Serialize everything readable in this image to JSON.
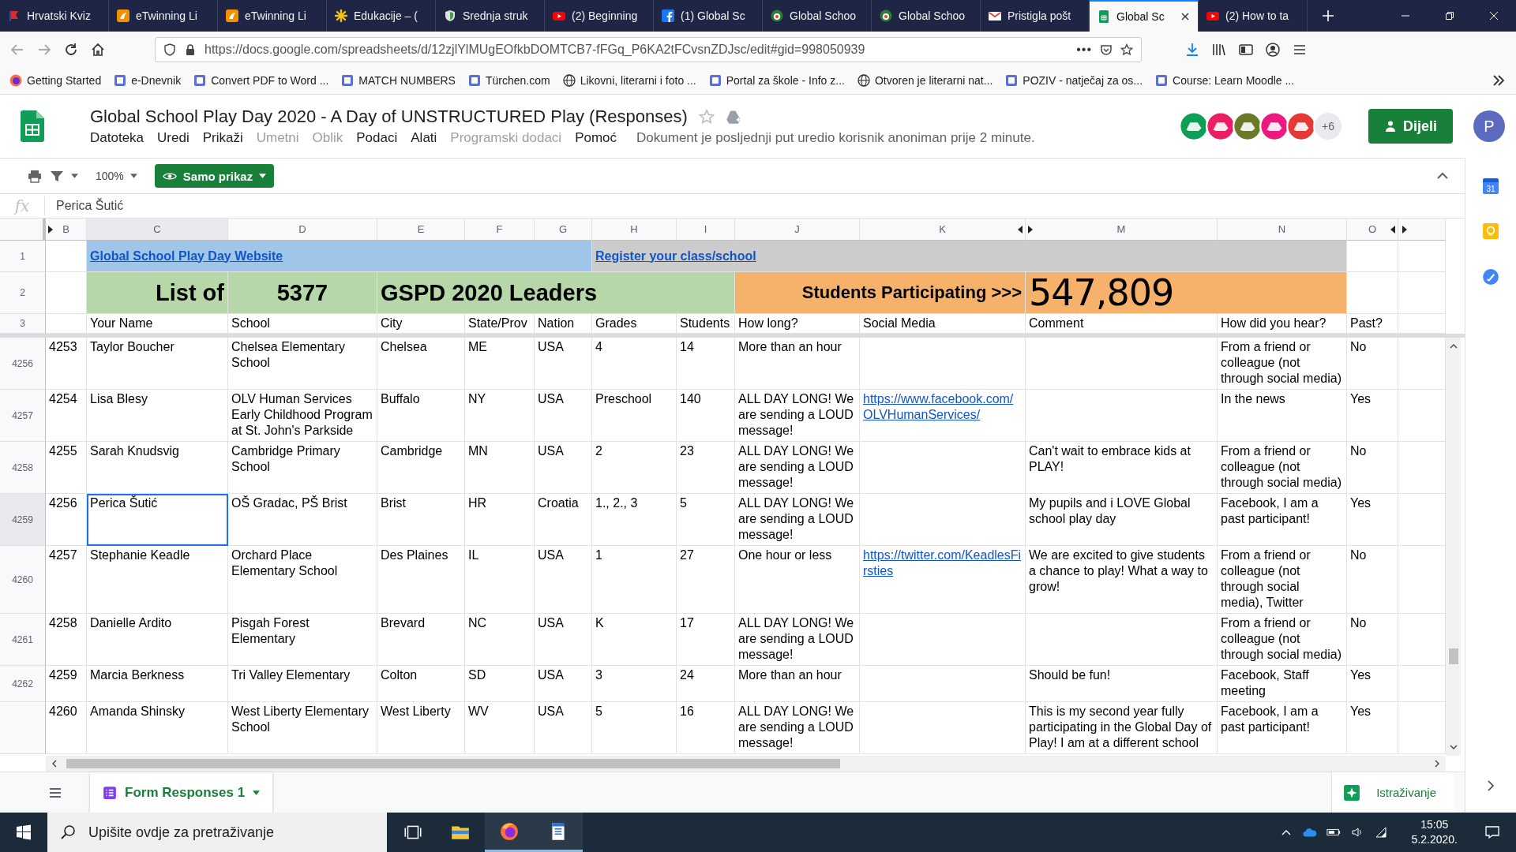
{
  "browser": {
    "tabs": [
      {
        "title": "Hrvatski Kviz",
        "kind": "flag",
        "selected": false
      },
      {
        "title": "eTwinning Li",
        "kind": "etwinning",
        "selected": false
      },
      {
        "title": "eTwinning Li",
        "kind": "etwinning",
        "selected": false
      },
      {
        "title": "Edukacije – (",
        "kind": "asterisk",
        "selected": false
      },
      {
        "title": "Srednja struk",
        "kind": "shield",
        "selected": false
      },
      {
        "title": "(2) Beginning",
        "kind": "youtube",
        "selected": false
      },
      {
        "title": "(1) Global Sc",
        "kind": "facebook",
        "selected": false
      },
      {
        "title": "Global Schoo",
        "kind": "globe",
        "selected": false
      },
      {
        "title": "Global Schoo",
        "kind": "globe",
        "selected": false
      },
      {
        "title": "Pristigla pošt",
        "kind": "gmail",
        "selected": false
      },
      {
        "title": "Global Sc",
        "kind": "sheets",
        "selected": true
      },
      {
        "title": "(2) How to ta",
        "kind": "youtube",
        "selected": false
      }
    ],
    "url": "https://docs.google.com/spreadsheets/d/12zjlYlMUgEOfkbDOMTCB7-fFGq_P6KA2tFCvsnZDJsc/edit#gid=998050939",
    "url_menu": "•••",
    "bookmarks": [
      {
        "label": "Getting Started",
        "kind": "firefox"
      },
      {
        "label": "e-Dnevnik",
        "kind": "site"
      },
      {
        "label": "Convert PDF to Word ...",
        "kind": "site"
      },
      {
        "label": "MATCH NUMBERS",
        "kind": "site"
      },
      {
        "label": "Türchen.com",
        "kind": "site"
      },
      {
        "label": "Likovni, literarni i foto ...",
        "kind": "globe"
      },
      {
        "label": "Portal za škole - Info z...",
        "kind": "site"
      },
      {
        "label": "Otvoren je literarni nat...",
        "kind": "globe"
      },
      {
        "label": "POZIV - natječaj za os...",
        "kind": "site"
      },
      {
        "label": "Course: Learn Moodle ...",
        "kind": "site"
      }
    ]
  },
  "document": {
    "title": "Global School Play Day 2020 - A Day of UNSTRUCTURED Play (Responses)",
    "menu": [
      {
        "label": "Datoteka",
        "disabled": false
      },
      {
        "label": "Uredi",
        "disabled": false
      },
      {
        "label": "Prikaži",
        "disabled": false
      },
      {
        "label": "Umetni",
        "disabled": true
      },
      {
        "label": "Oblik",
        "disabled": true
      },
      {
        "label": "Podaci",
        "disabled": false
      },
      {
        "label": "Alati",
        "disabled": false
      },
      {
        "label": "Programski dodaci",
        "disabled": true
      },
      {
        "label": "Pomoć",
        "disabled": false
      }
    ],
    "last_edit": "Dokument je posljednji put uredio korisnik anoniman prije 2 minute.",
    "viewers": [
      {
        "color": "#0f9d58"
      },
      {
        "color": "#e91e63"
      },
      {
        "color": "#6b7a2a"
      },
      {
        "color": "#ec1a7f"
      },
      {
        "color": "#e53935"
      }
    ],
    "more_viewers": "+6",
    "share": "Dijeli",
    "profile": "P"
  },
  "toolbar": {
    "zoom": "100%",
    "mode": "Samo prikaz"
  },
  "formula_bar": {
    "label": "fx",
    "value": "Perica Šutić"
  },
  "sheet": {
    "columns": [
      {
        "letter": "B",
        "kind": "text",
        "hidden_before": true,
        "hidden_after": false,
        "selected": false
      },
      {
        "letter": "C",
        "kind": "text",
        "hidden_before": false,
        "hidden_after": false,
        "selected": true
      },
      {
        "letter": "D",
        "kind": "text",
        "hidden_before": false,
        "hidden_after": false,
        "selected": false
      },
      {
        "letter": "E",
        "kind": "text",
        "hidden_before": false,
        "hidden_after": false,
        "selected": false
      },
      {
        "letter": "F",
        "kind": "text",
        "hidden_before": false,
        "hidden_after": false,
        "selected": false
      },
      {
        "letter": "G",
        "kind": "text",
        "hidden_before": false,
        "hidden_after": false,
        "selected": false
      },
      {
        "letter": "H",
        "kind": "text",
        "hidden_before": false,
        "hidden_after": false,
        "selected": false
      },
      {
        "letter": "I",
        "kind": "text",
        "hidden_before": false,
        "hidden_after": false,
        "selected": false
      },
      {
        "letter": "J",
        "kind": "text",
        "hidden_before": false,
        "hidden_after": false,
        "selected": false
      },
      {
        "letter": "K",
        "kind": "link",
        "hidden_before": false,
        "hidden_after": true,
        "selected": false
      },
      {
        "letter": "M",
        "kind": "text",
        "hidden_before": true,
        "hidden_after": false,
        "selected": false
      },
      {
        "letter": "N",
        "kind": "text",
        "hidden_before": false,
        "hidden_after": false,
        "selected": false
      },
      {
        "letter": "O",
        "kind": "text",
        "hidden_before": false,
        "hidden_after": true,
        "selected": false
      }
    ],
    "row_1": {
      "number": "1",
      "website_link": "Global School Play Day Website",
      "register_link": "Register your class/school"
    },
    "row_2": {
      "number": "2",
      "list_label": "List of",
      "leader_count": "5377",
      "leaders_label": "GSPD 2020 Leaders",
      "students_label": "Students Participating >>>",
      "students_total": "547,809"
    },
    "header_row": {
      "number": "3",
      "labels": {
        "C": "Your Name",
        "D": "School",
        "E": "City",
        "F": "State/Prov",
        "G": "Nation",
        "H": "Grades",
        "I": "Students",
        "J": "How long?",
        "K": "Social Media",
        "M": "Comment",
        "N": "How did you hear?",
        "O": "Past?"
      }
    },
    "rows": [
      {
        "number": "4256",
        "selected": false,
        "cells": {
          "B": "4253",
          "C": "Taylor Boucher",
          "D": "Chelsea Elementary School",
          "E": "Chelsea",
          "F": "ME",
          "G": "USA",
          "H": "4",
          "I": "14",
          "J": "More than an hour",
          "N": "From a friend or colleague (not through social media)",
          "O": "No"
        }
      },
      {
        "number": "4257",
        "selected": false,
        "cells": {
          "B": "4254",
          "C": "Lisa Blesy",
          "D": "OLV Human Services Early Childhood Program at St. John's Parkside",
          "E": "Buffalo",
          "F": "NY",
          "G": "USA",
          "H": "Preschool",
          "I": "140",
          "J": "ALL DAY LONG! We are sending a LOUD message!",
          "K": "https://www.facebook.com/OLVHumanServices/",
          "N": "In the news",
          "O": "Yes"
        }
      },
      {
        "number": "4258",
        "selected": false,
        "cells": {
          "B": "4255",
          "C": "Sarah Knudsvig",
          "D": "Cambridge Primary School",
          "E": "Cambridge",
          "F": "MN",
          "G": "USA",
          "H": "2",
          "I": "23",
          "J": "ALL DAY LONG! We are sending a LOUD message!",
          "M": "Can't wait to embrace kids at PLAY!",
          "N": "From a friend or colleague (not through social media)",
          "O": "No"
        }
      },
      {
        "number": "4259",
        "selected": true,
        "cells": {
          "B": "4256",
          "C": "Perica Šutić",
          "D": "OŠ Gradac, PŠ Brist",
          "E": "Brist",
          "F": "HR",
          "G": "Croatia",
          "H": "1., 2., 3",
          "I": "5",
          "J": "ALL DAY LONG! We are sending a LOUD message!",
          "M": "My pupils and i LOVE Global school play day",
          "N": "Facebook, I am a past participant!",
          "O": "Yes"
        }
      },
      {
        "number": "4260",
        "selected": false,
        "cells": {
          "B": "4257",
          "C": "Stephanie Keadle",
          "D": "Orchard Place Elementary School",
          "E": "Des Plaines",
          "F": "IL",
          "G": "USA",
          "H": "1",
          "I": "27",
          "J": "One hour or less",
          "K": "https://twitter.com/KeadlesFirsties",
          "M": "We are excited to give students a chance to play! What a way to grow!",
          "N": "From a friend or colleague (not through social media), Twitter",
          "O": "No"
        }
      },
      {
        "number": "4261",
        "selected": false,
        "cells": {
          "B": "4258",
          "C": "Danielle Ardito",
          "D": "Pisgah Forest Elementary",
          "E": "Brevard",
          "F": "NC",
          "G": "USA",
          "H": "K",
          "I": "17",
          "J": "ALL DAY LONG! We are sending a LOUD message!",
          "N": "From a friend or colleague (not through social media)",
          "O": "No"
        }
      },
      {
        "number": "4262",
        "selected": false,
        "cells": {
          "B": "4259",
          "C": "Marcia Berkness",
          "D": "Tri Valley Elementary",
          "E": "Colton",
          "F": "SD",
          "G": "USA",
          "H": "3",
          "I": "24",
          "J": "More than an hour",
          "M": "Should be fun!",
          "N": "Facebook, Staff meeting",
          "O": "Yes"
        }
      },
      {
        "selected": false,
        "cells": {
          "B": "4260",
          "C": "Amanda Shinsky",
          "D": "West Liberty Elementary School",
          "E": "West Liberty",
          "F": "WV",
          "G": "USA",
          "H": "5",
          "I": "16",
          "J": "ALL DAY LONG! We are sending a LOUD message!",
          "M": "This is my second year fully participating in the Global Day of Play! I am at a different school",
          "N": "Facebook, I am a past participant!",
          "O": "Yes"
        }
      }
    ]
  },
  "sheet_tabs": [
    {
      "label": "Form Responses 1",
      "selected": true
    }
  ],
  "explore": "Istraživanje",
  "side_panel": {
    "calendar_day": "31"
  },
  "taskbar": {
    "search_placeholder": "Upišite ovdje za pretraživanje",
    "time": "15:05",
    "date": "5.2.2020."
  }
}
